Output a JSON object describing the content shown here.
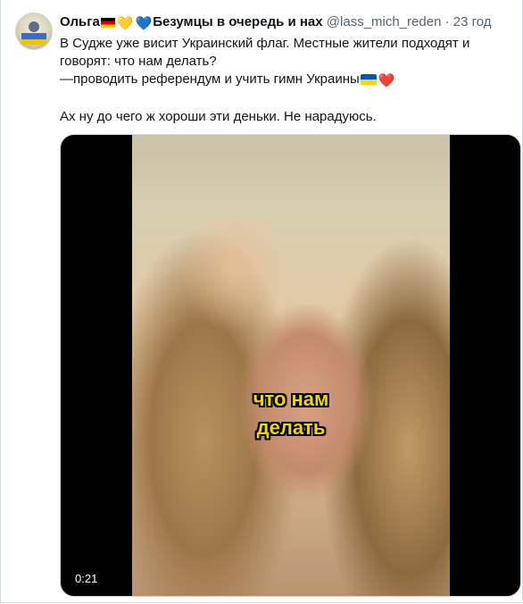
{
  "tweet": {
    "author_name": "Ольга",
    "author_suffix": "Безумцы в очередь и нах",
    "handle": "@lass_mich_reden",
    "separator": "·",
    "time": "23 год",
    "emoji": [
      "german-flag",
      "yellow-heart",
      "blue-heart",
      "ukraine-flag",
      "red-heart"
    ],
    "text_line1": "В Судже уже висит Украинский флаг. Местные жители подходят и",
    "text_line2": "говорят: что нам делать?",
    "text_line3": "—проводить референдум и учить гимн Украины",
    "text_line4": "Ах ну до чего ж хороши эти деньки. Не нарадуюсь."
  },
  "media": {
    "caption_line1": "что нам",
    "caption_line2": "делать",
    "duration": "0:21"
  }
}
